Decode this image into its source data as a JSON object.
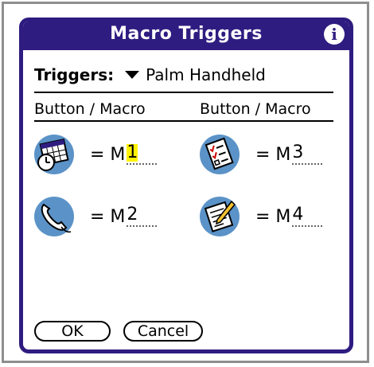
{
  "dialog": {
    "title": "Macro Triggers"
  },
  "triggers": {
    "label": "Triggers:",
    "selected": "Palm Handheld"
  },
  "columns": {
    "left": "Button / Macro",
    "right": "Button / Macro"
  },
  "assignments": [
    {
      "icon": "calendar-clock-icon",
      "prefix": "= M",
      "value": "1"
    },
    {
      "icon": "todo-list-icon",
      "prefix": "= M",
      "value": "3"
    },
    {
      "icon": "phone-icon",
      "prefix": "= M",
      "value": "2"
    },
    {
      "icon": "memo-pad-icon",
      "prefix": "= M",
      "value": "4"
    }
  ],
  "buttons": {
    "ok": "OK",
    "cancel": "Cancel"
  },
  "colors": {
    "titlebar": "#2f1c80",
    "icon_bg": "#5b93c8",
    "highlight": "#fff200"
  }
}
